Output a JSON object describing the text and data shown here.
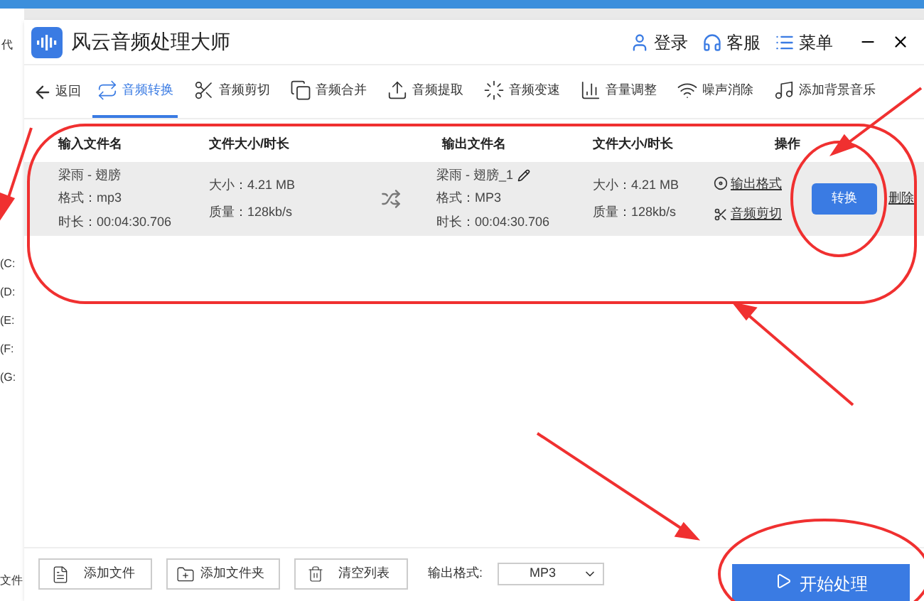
{
  "background_window": {
    "top_char": "代",
    "drives": [
      "(C:",
      "(D:",
      "(E:",
      "(F:",
      "(G:"
    ],
    "bottom_text": "文件"
  },
  "window": {
    "title": "风云音频处理大师",
    "actions": [
      {
        "kind": "user",
        "label": "登录"
      },
      {
        "kind": "support",
        "label": "客服"
      },
      {
        "kind": "menu",
        "label": "菜单"
      }
    ]
  },
  "toolbar": {
    "back": "返回",
    "tools": [
      {
        "kind": "convert",
        "label": "音频转换",
        "selected": true
      },
      {
        "kind": "cut",
        "label": "音频剪切",
        "selected": false
      },
      {
        "kind": "merge",
        "label": "音频合并",
        "selected": false
      },
      {
        "kind": "extract",
        "label": "音频提取",
        "selected": false
      },
      {
        "kind": "speed",
        "label": "音频变速",
        "selected": false
      },
      {
        "kind": "volume",
        "label": "音量调整",
        "selected": false
      },
      {
        "kind": "noise",
        "label": "噪声消除",
        "selected": false
      },
      {
        "kind": "music",
        "label": "添加背景音乐",
        "selected": false
      }
    ]
  },
  "table": {
    "columns": [
      "输入文件名",
      "文件大小/时长",
      "输出文件名",
      "文件大小/时长",
      "操作"
    ],
    "rows": [
      {
        "input_name": "梁雨 - 翅膀",
        "input_format": "格式：mp3",
        "input_duration": "时长：00:04:30.706",
        "input_size": "大小：4.21 MB",
        "input_quality": "质量：128kb/s",
        "output_name": "梁雨 - 翅膀_1",
        "output_format": "格式：MP3",
        "output_duration": "时长：00:04:30.706",
        "output_size": "大小：4.21 MB",
        "output_quality": "质量：128kb/s",
        "links": [
          "输出格式",
          "音频剪切"
        ],
        "convert": "转换",
        "delete": "删除"
      }
    ]
  },
  "bottom_bar": {
    "add_file": "添加文件",
    "add_folder": "添加文件夹",
    "clear": "清空列表",
    "format_label": "输出格式:",
    "format_value": "MP3",
    "start": "开始处理"
  }
}
